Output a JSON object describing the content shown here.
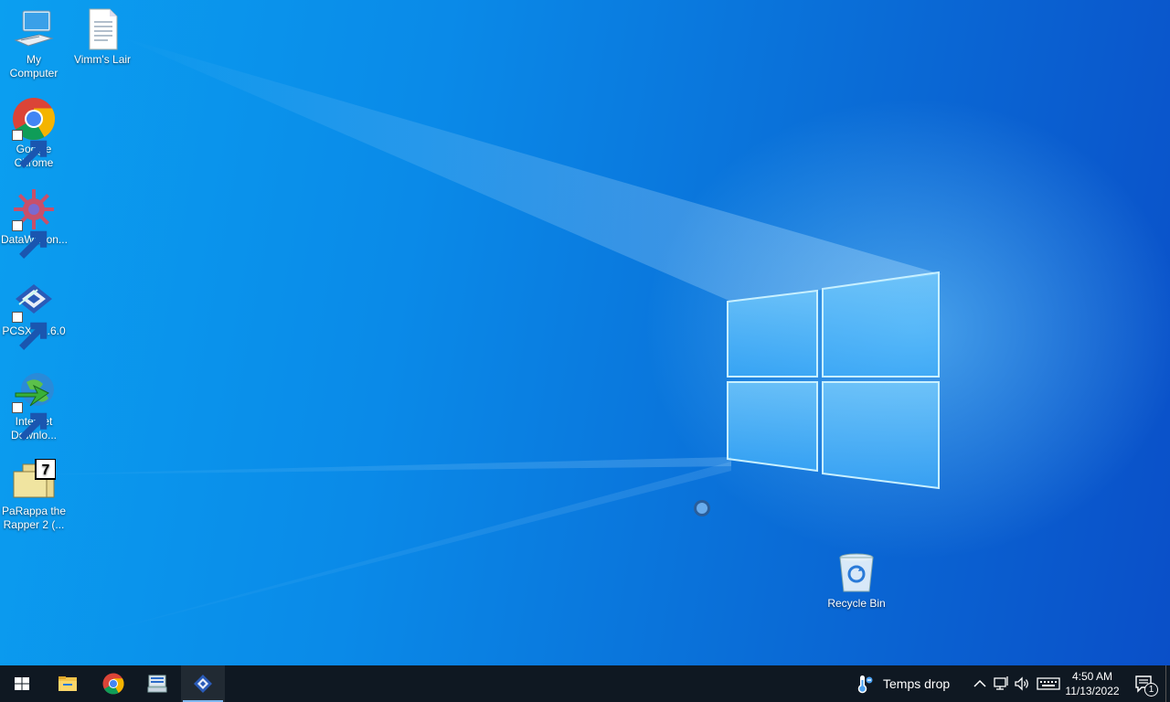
{
  "desktop": {
    "icons": [
      {
        "label": "My Computer",
        "icon": "my-computer-icon"
      },
      {
        "label": "Vimm's Lair",
        "icon": "text-file-icon"
      },
      {
        "label": "Google Chrome",
        "icon": "chrome-icon"
      },
      {
        "label": "DataWagon...",
        "icon": "datawagon-icon"
      },
      {
        "label": "PCSX2 1.6.0",
        "icon": "pcsx2-icon"
      },
      {
        "label": "Internet Downlo...",
        "icon": "internet-download-manager-icon"
      },
      {
        "label": "PaRappa the Rapper 2 (...",
        "icon": "7zip-archive-icon"
      },
      {
        "label": "Recycle Bin",
        "icon": "recycle-bin-icon"
      }
    ]
  },
  "taskbar": {
    "start_icon": "windows-start-icon",
    "pinned": [
      {
        "icon": "file-explorer-icon"
      },
      {
        "icon": "chrome-icon"
      },
      {
        "icon": "network-app-icon"
      },
      {
        "icon": "pcsx2-icon",
        "active": true
      }
    ],
    "weather": {
      "text": "Temps drop",
      "icon": "thermometer-icon"
    },
    "tray": [
      "chevron-up-icon",
      "network-icon",
      "volume-icon",
      "keyboard-icon"
    ],
    "clock": {
      "time": "4:50 AM",
      "date": "11/13/2022"
    },
    "notifications": {
      "count": "1",
      "icon": "notification-icon"
    }
  },
  "colors": {
    "desktop_blue": "#0a8ae8",
    "taskbar": "#0f1822"
  }
}
